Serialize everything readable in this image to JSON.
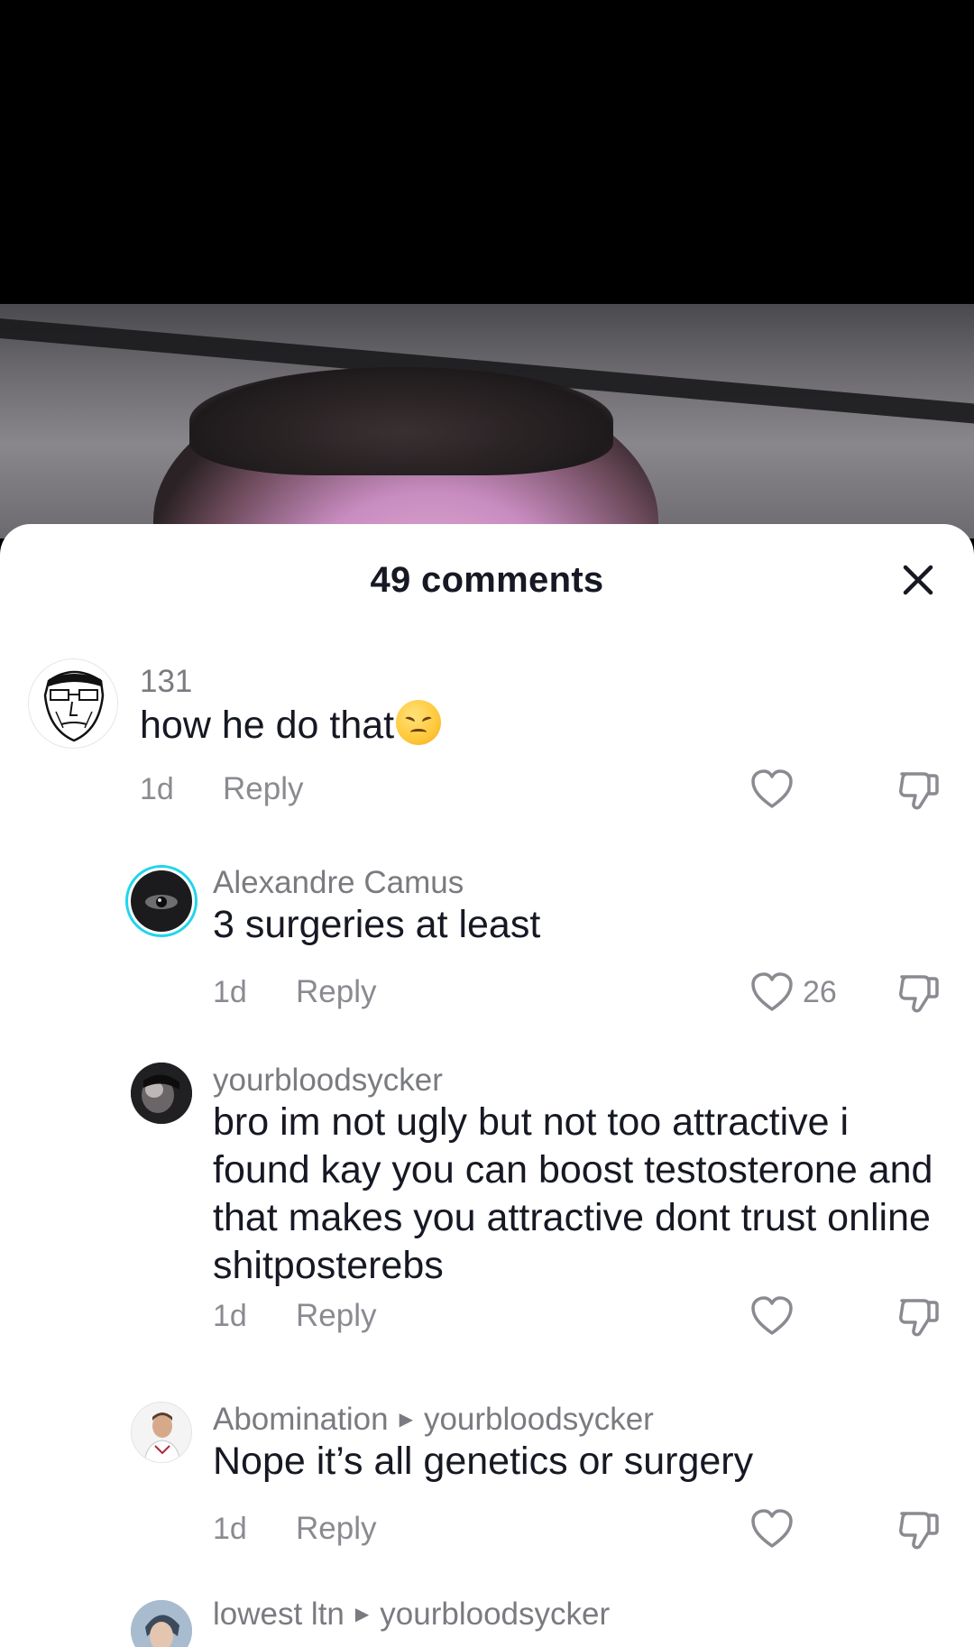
{
  "sheet": {
    "title": "49 comments"
  },
  "comments": [
    {
      "username": "131",
      "text": "how he do that",
      "emoji": "disappointed-face",
      "time": "1d",
      "reply_label": "Reply",
      "likes": ""
    },
    {
      "username": "Alexandre Camus",
      "text": "3 surgeries at least",
      "time": "1d",
      "reply_label": "Reply",
      "likes": "26"
    },
    {
      "username": "yourbloodsycker",
      "text": "bro im not ugly but not too attractive i found kay you can boost testosterone and that makes you attractive dont trust online shitposterebs",
      "time": "1d",
      "reply_label": "Reply",
      "likes": ""
    },
    {
      "username": "Abomination",
      "reply_to": "yourbloodsycker",
      "text": "Nope it’s all genetics or surgery",
      "time": "1d",
      "reply_label": "Reply",
      "likes": ""
    },
    {
      "username": "lowest ltn",
      "reply_to": "yourbloodsycker"
    }
  ],
  "colors": {
    "text_primary": "#161823",
    "text_secondary": "#8a8b91",
    "avatar_ring": "#20d5ec"
  },
  "icons": [
    "close-icon",
    "heart-outline-icon",
    "thumb-down-outline-icon",
    "caret-right-icon"
  ]
}
